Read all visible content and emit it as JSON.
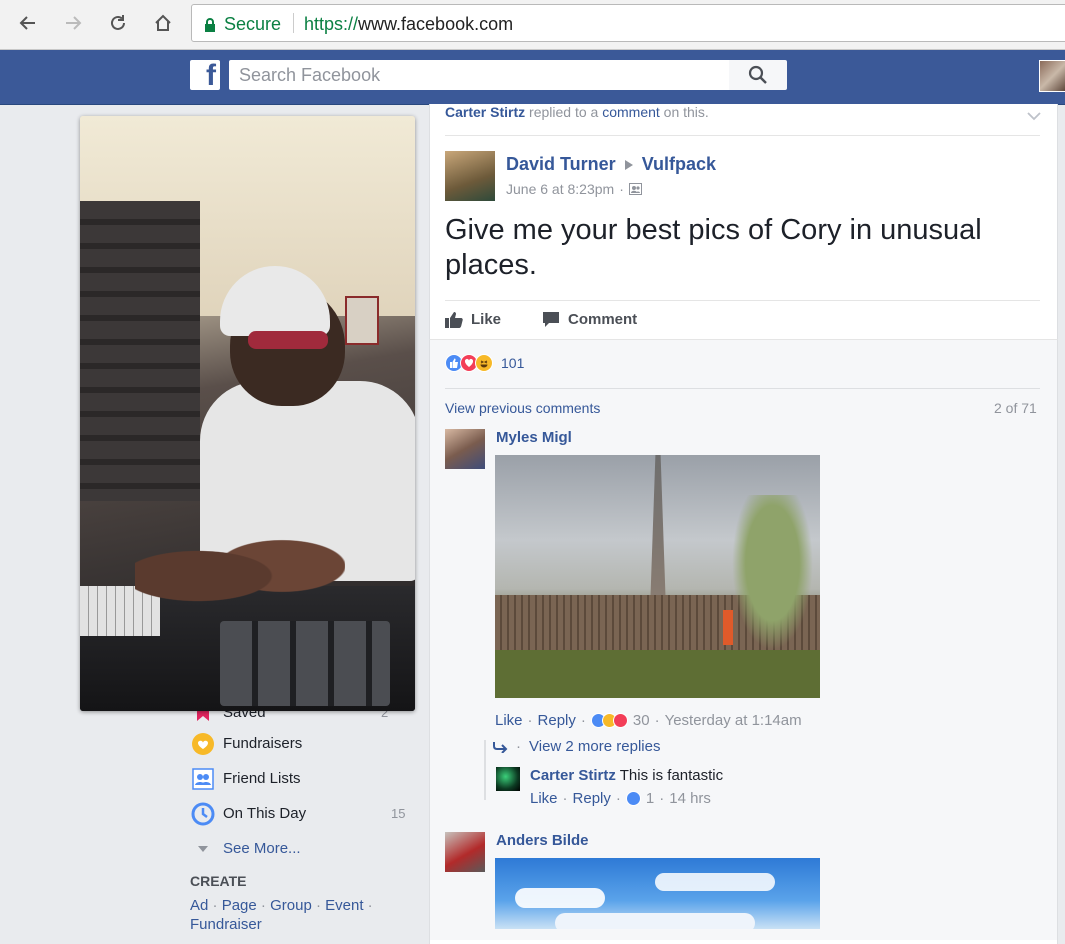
{
  "browser": {
    "secure_label": "Secure",
    "url_scheme": "https://",
    "url_host": "www.facebook.com"
  },
  "fb": {
    "logo_letter": "f",
    "search_placeholder": "Search Facebook"
  },
  "left": {
    "saved_label": "Saved",
    "saved_count": "2",
    "items": [
      {
        "label": "Fundraisers",
        "count": ""
      },
      {
        "label": "Friend Lists",
        "count": ""
      },
      {
        "label": "On This Day",
        "count": "15"
      }
    ],
    "see_more": "See More...",
    "create_title": "CREATE",
    "create_links": [
      "Ad",
      "Page",
      "Group",
      "Event",
      "Fundraiser"
    ]
  },
  "story_header": {
    "actor": "Carter Stirtz",
    "text1": " replied to a ",
    "link": "comment",
    "text2": " on this."
  },
  "post": {
    "author": "David Turner",
    "group": "Vulfpack",
    "time": "June 6 at 8:23pm",
    "text": "Give me your best pics of Cory in unusual places.",
    "like_label": "Like",
    "comment_label": "Comment",
    "reaction_count": "101",
    "view_previous": "View previous comments",
    "comment_pos": "2 of 71"
  },
  "comments": [
    {
      "author": "Myles Migl",
      "like": "Like",
      "reply": "Reply",
      "reaction_count": "30",
      "time": "Yesterday at 1:14am",
      "more_replies": "View 2 more replies",
      "reply_item": {
        "author": "Carter Stirtz",
        "text": "This is fantastic",
        "like": "Like",
        "reply": "Reply",
        "reaction_count": "1",
        "time": "14 hrs"
      }
    },
    {
      "author": "Anders Bilde"
    }
  ],
  "colors": {
    "fb_blue": "#3b5998",
    "link": "#365899",
    "muted": "#90949c",
    "secure_green": "#0b8043"
  }
}
